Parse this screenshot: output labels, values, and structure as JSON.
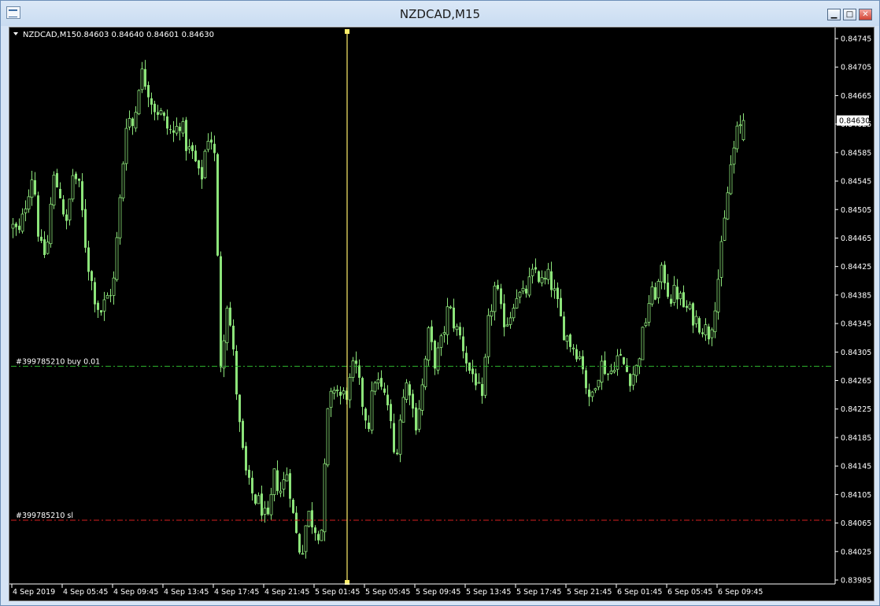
{
  "window": {
    "title": "NZDCAD,M15",
    "min_glyph": "▁",
    "max_glyph": "□",
    "close_glyph": "✕"
  },
  "chart_header": {
    "symbol": "NZDCAD,M15",
    "ohlc": "0.84603 0.84640 0.84601 0.84630"
  },
  "current_price_label": "0.84630",
  "orders": [
    {
      "label": "#399785210 buy 0.01",
      "price": 0.84285,
      "color": "#2db52d"
    },
    {
      "label": "#399785210 sl",
      "price": 0.84069,
      "color": "#d62020"
    }
  ],
  "colors": {
    "background": "#000000",
    "candle": "#8ce47a",
    "axis_text": "#ffffff",
    "cursor_line": "#ffee6a"
  },
  "chart_data": {
    "type": "candlestick",
    "symbol": "NZDCAD",
    "timeframe": "M15",
    "y_ticks": [
      "0.84745",
      "0.84705",
      "0.84665",
      "0.84625",
      "0.84585",
      "0.84545",
      "0.84505",
      "0.84465",
      "0.84425",
      "0.84385",
      "0.84345",
      "0.84305",
      "0.84265",
      "0.84225",
      "0.84185",
      "0.84145",
      "0.84105",
      "0.84065",
      "0.84025",
      "0.83985"
    ],
    "ylim": [
      0.83985,
      0.84745
    ],
    "x_ticks": [
      "4 Sep 2019",
      "4 Sep 05:45",
      "4 Sep 09:45",
      "4 Sep 13:45",
      "4 Sep 17:45",
      "4 Sep 21:45",
      "5 Sep 01:45",
      "5 Sep 05:45",
      "5 Sep 09:45",
      "5 Sep 13:45",
      "5 Sep 17:45",
      "5 Sep 21:45",
      "6 Sep 01:45",
      "6 Sep 05:45",
      "6 Sep 09:45"
    ],
    "bars_per_tick": 16,
    "close_path": [
      0.8448,
      0.8447,
      0.8452,
      0.8456,
      0.8445,
      0.8444,
      0.8455,
      0.8453,
      0.8448,
      0.8456,
      0.8453,
      0.8444,
      0.8439,
      0.8436,
      0.8438,
      0.844,
      0.8452,
      0.8464,
      0.8462,
      0.847,
      0.8468,
      0.8465,
      0.8464,
      0.8462,
      0.8461,
      0.8463,
      0.8459,
      0.8458,
      0.8454,
      0.8461,
      0.846,
      0.8429,
      0.8438,
      0.8429,
      0.8418,
      0.8412,
      0.841,
      0.8409,
      0.8406,
      0.8413,
      0.8411,
      0.8414,
      0.8406,
      0.8402,
      0.8408,
      0.8406,
      0.8405,
      0.8422,
      0.8426,
      0.8424,
      0.8425,
      0.8429,
      0.8424,
      0.842,
      0.8427,
      0.8425,
      0.8423,
      0.8415,
      0.8423,
      0.8427,
      0.842,
      0.8425,
      0.8433,
      0.8429,
      0.8432,
      0.8437,
      0.8434,
      0.8432,
      0.8428,
      0.8427,
      0.8423,
      0.8435,
      0.844,
      0.8435,
      0.8435,
      0.8439,
      0.8438,
      0.844,
      0.8442,
      0.844,
      0.8441,
      0.8438,
      0.8434,
      0.8432,
      0.8431,
      0.8429,
      0.8423,
      0.8427,
      0.8429,
      0.8427,
      0.843,
      0.8429,
      0.8427,
      0.8428,
      0.8433,
      0.8438,
      0.8439,
      0.8442,
      0.8438,
      0.8439,
      0.8437,
      0.8436,
      0.8435,
      0.8434,
      0.8433,
      0.8439,
      0.8447,
      0.8456,
      0.8461,
      0.8463
    ],
    "current_price": 0.8463,
    "last_bar_ohlc": {
      "open": 0.84603,
      "high": 0.8464,
      "low": 0.84601,
      "close": 0.8463
    }
  }
}
